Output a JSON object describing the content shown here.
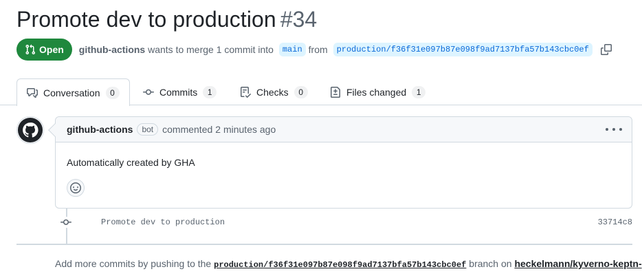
{
  "pr": {
    "title": "Promote dev to production",
    "number": "#34",
    "state": "Open",
    "author": "github-actions",
    "merge_text_1": "wants to merge 1 commit into",
    "base_branch": "main",
    "from_text": "from",
    "head_branch": "production/f36f31e097b87e098f9ad7137bfa57b143cbc0ef"
  },
  "tabs": [
    {
      "label": "Conversation",
      "count": "0",
      "icon": "comment-discussion-icon"
    },
    {
      "label": "Commits",
      "count": "1",
      "icon": "git-commit-icon"
    },
    {
      "label": "Checks",
      "count": "0",
      "icon": "checklist-icon"
    },
    {
      "label": "Files changed",
      "count": "1",
      "icon": "file-diff-icon"
    }
  ],
  "comment": {
    "author": "github-actions",
    "badge": "bot",
    "action_text": "commented",
    "time": "2 minutes ago",
    "body": "Automatically created by GHA"
  },
  "timeline": {
    "commit_message": "Promote dev to production",
    "commit_sha": "33714c8"
  },
  "footer": {
    "prefix": "Add more commits by pushing to the",
    "branch": "production/f36f31e097b87e098f9ad7137bfa57b143cbc0ef",
    "middle": "branch on",
    "repo": "heckelmann/kyverno-keptn-"
  },
  "colors": {
    "open_green": "#1f883d",
    "link_blue": "#0969da",
    "branch_bg": "#ddf4ff",
    "border": "#d1d9e0",
    "muted_text": "#59636e"
  }
}
